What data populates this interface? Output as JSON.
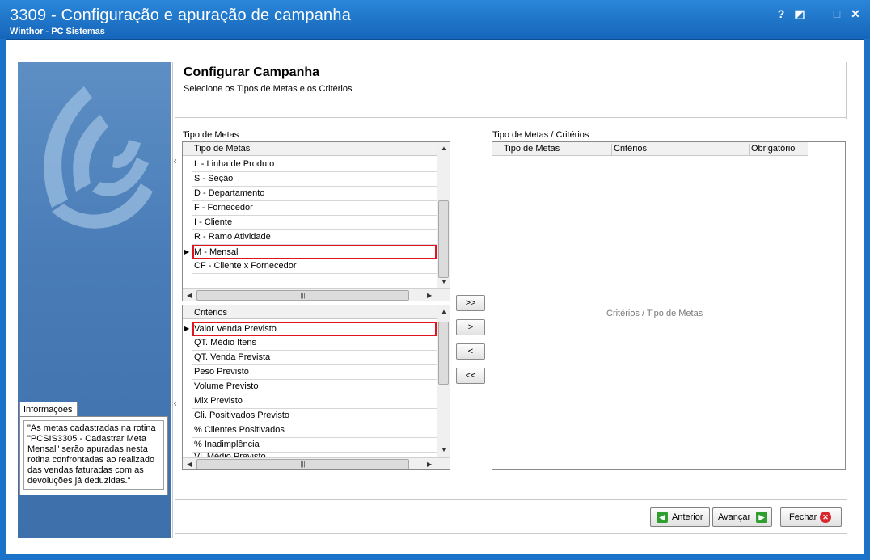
{
  "window": {
    "title": "3309 - Configuração e apuração de campanha",
    "subtitle": "Winthor - PC Sistemas",
    "controls": [
      "?",
      "◩",
      "_",
      "□",
      "✕"
    ]
  },
  "page": {
    "title": "Configurar Campanha",
    "description": "Selecione os Tipos de Metas e os Critérios"
  },
  "sidebar": {
    "info_tab": "Informações",
    "info_text": "\"As metas cadastradas na rotina \"PCSIS3305 - Cadastrar Meta Mensal\" serão apuradas nesta rotina confrontadas ao realizado das vendas faturadas com as devoluções já deduzidas.\""
  },
  "tipo_metas": {
    "group_label": "Tipo de Metas",
    "header": "Tipo de Metas",
    "rows": [
      "L - Linha de Produto",
      "S - Seção",
      "D - Departamento",
      "F - Fornecedor",
      "I - Cliente",
      "R - Ramo Atividade",
      "M - Mensal",
      "CF - Cliente x Fornecedor"
    ],
    "selected_index": 6
  },
  "criterios": {
    "header": "Critérios",
    "rows": [
      "Valor Venda Previsto",
      "QT. Médio Itens",
      "QT. Venda Prevista",
      "Peso Previsto",
      "Volume Previsto",
      "Mix Previsto",
      "Cli. Positivados Previsto",
      "% Clientes Positivados",
      "% Inadimplência",
      "Vl. Médio Previsto"
    ],
    "selected_index": 0
  },
  "movers": {
    "add_all": ">>",
    "add": ">",
    "remove": "<",
    "remove_all": "<<"
  },
  "result": {
    "group_label": "Tipo de Metas / Critérios",
    "columns": [
      "Tipo de Metas",
      "Critérios",
      "Obrigatório"
    ],
    "empty_text": "Critérios / Tipo de Metas"
  },
  "footer": {
    "back": "Anterior",
    "next": "Avançar",
    "close": "Fechar"
  },
  "colors": {
    "title_bar": "#1a73c9",
    "selection_border": "#e0141f",
    "nav_icon": "#2fa02f",
    "close_icon": "#d8282e"
  }
}
